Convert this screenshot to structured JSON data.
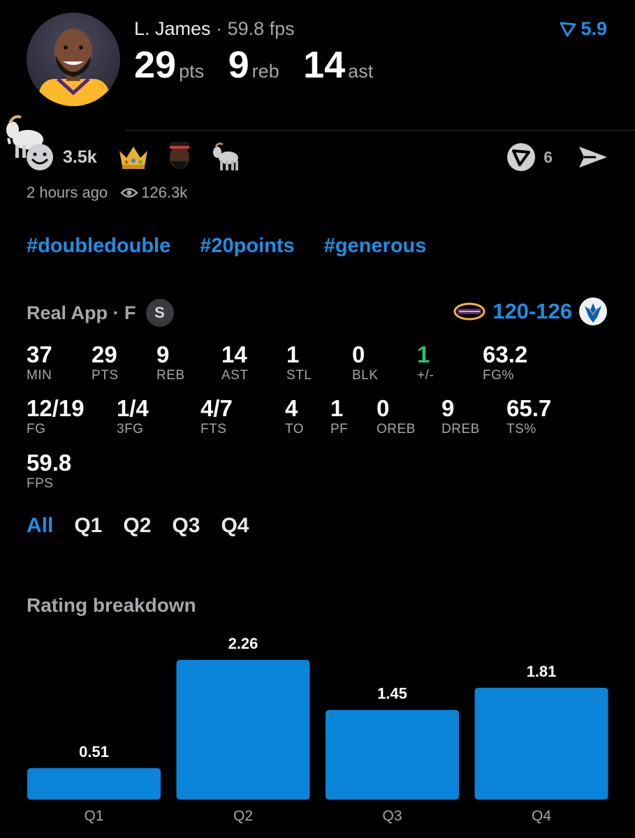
{
  "header": {
    "player_name": "L. James",
    "separator": "·",
    "fps_text": "59.8 fps",
    "rating": "5.9",
    "pts": "29",
    "pts_unit": "pts",
    "reb": "9",
    "reb_unit": "reb",
    "ast": "14",
    "ast_unit": "ast"
  },
  "reactions": {
    "count": "3.5k",
    "emojis": [
      "crown-emoji",
      "player-emoji",
      "goat-emoji"
    ],
    "comment_count": "6"
  },
  "meta": {
    "time": "2 hours ago",
    "views": "126.3k"
  },
  "hashtags": [
    "#doubledouble",
    "#20points",
    "#generous"
  ],
  "game": {
    "source": "Real App · F",
    "badge": "S",
    "score_home": "120",
    "score_dash": "-",
    "score_away": "126"
  },
  "stats": [
    {
      "value": "37",
      "label": "MIN"
    },
    {
      "value": "29",
      "label": "PTS"
    },
    {
      "value": "9",
      "label": "REB"
    },
    {
      "value": "14",
      "label": "AST"
    },
    {
      "value": "1",
      "label": "STL"
    },
    {
      "value": "0",
      "label": "BLK"
    },
    {
      "value": "1",
      "label": "+/-"
    },
    {
      "value": "63.2",
      "label": "FG%"
    },
    {
      "value": "12/19",
      "label": "FG"
    },
    {
      "value": "1/4",
      "label": "3FG"
    },
    {
      "value": "4/7",
      "label": "FTS"
    },
    {
      "value": "4",
      "label": "TO"
    },
    {
      "value": "1",
      "label": "PF"
    },
    {
      "value": "0",
      "label": "OREB"
    },
    {
      "value": "9",
      "label": "DREB"
    },
    {
      "value": "65.7",
      "label": "TS%"
    },
    {
      "value": "59.8",
      "label": "FPS"
    }
  ],
  "tabs": [
    "All",
    "Q1",
    "Q2",
    "Q3",
    "Q4"
  ],
  "active_tab": "All",
  "breakdown_title": "Rating breakdown",
  "colors": {
    "accent": "#1d8fe6",
    "bar": "#0a84d8",
    "positive": "#2ec26a",
    "lakers_gold": "#fdb927",
    "lakers_purple": "#552583"
  },
  "chart_data": {
    "type": "bar",
    "categories": [
      "Q1",
      "Q2",
      "Q3",
      "Q4"
    ],
    "values": [
      0.51,
      2.26,
      1.45,
      1.81
    ],
    "data_labels": [
      "0.51",
      "2.26",
      "1.45",
      "1.81"
    ],
    "title": "Rating breakdown",
    "ylim": [
      0,
      2.26
    ],
    "grid": false
  }
}
